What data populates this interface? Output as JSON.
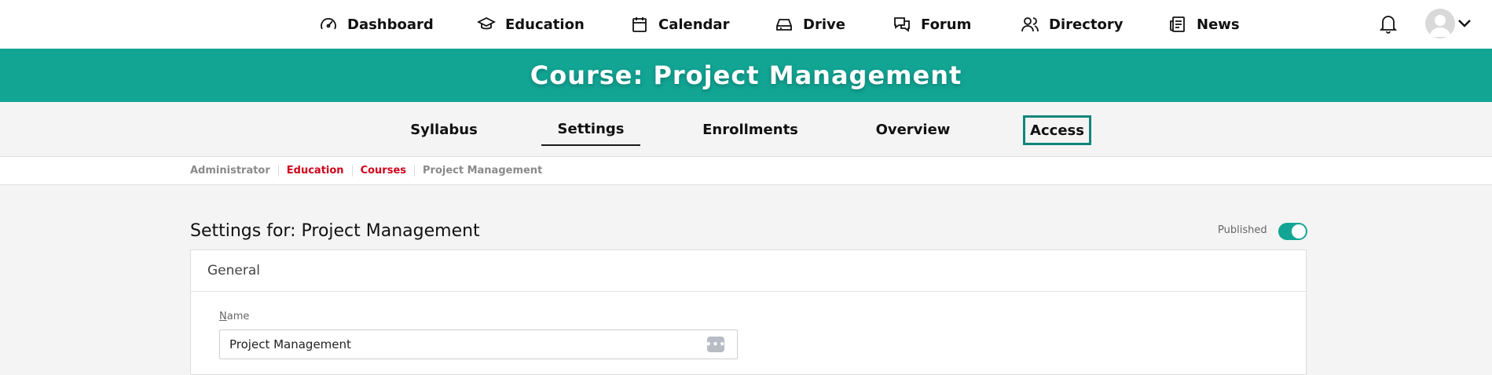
{
  "nav": {
    "items": [
      {
        "label": "Dashboard",
        "icon": "gauge-icon"
      },
      {
        "label": "Education",
        "icon": "graduation-cap-icon"
      },
      {
        "label": "Calendar",
        "icon": "calendar-icon"
      },
      {
        "label": "Drive",
        "icon": "drive-icon"
      },
      {
        "label": "Forum",
        "icon": "chat-bubbles-icon"
      },
      {
        "label": "Directory",
        "icon": "people-icon"
      },
      {
        "label": "News",
        "icon": "newspaper-icon"
      }
    ]
  },
  "banner": {
    "title": "Course: Project Management"
  },
  "tabs": [
    {
      "label": "Syllabus",
      "state": "normal"
    },
    {
      "label": "Settings",
      "state": "active"
    },
    {
      "label": "Enrollments",
      "state": "normal"
    },
    {
      "label": "Overview",
      "state": "normal"
    },
    {
      "label": "Access",
      "state": "focused"
    }
  ],
  "breadcrumb": [
    {
      "label": "Administrator",
      "link": false
    },
    {
      "label": "Education",
      "link": true
    },
    {
      "label": "Courses",
      "link": true
    },
    {
      "label": "Project Management",
      "link": false
    }
  ],
  "page": {
    "title": "Settings for: Project Management",
    "published_label": "Published",
    "published": true
  },
  "card": {
    "header": "General",
    "name_label_first": "N",
    "name_label_rest": "ame",
    "name_value": "Project Management",
    "more_label": "•••"
  },
  "colors": {
    "accent": "#12a594",
    "link": "#d0021b",
    "focus": "#12857a"
  }
}
